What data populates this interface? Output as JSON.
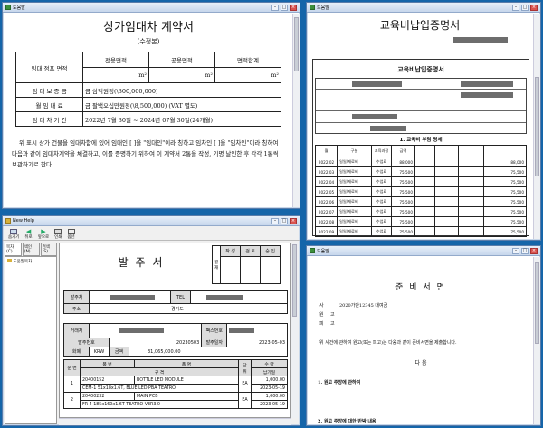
{
  "w1": {
    "title": "도움말",
    "doc": {
      "title": "상가임대차 계약서",
      "subtitle": "(수정본)",
      "row_area": "임대 점포 면적",
      "h_excl": "전용면적",
      "h_common": "공용면적",
      "h_total": "면적합계",
      "unit": "m²",
      "row_deposit": "임 대 보 증 금",
      "deposit": "금 삼억원정(\\300,000,000)",
      "row_rent": "월  임  대  료",
      "rent": "금 팔백오십만원정(\\8,500,000) (VAT 별도)",
      "row_period": "임 대 차 기 간",
      "period": "2022년 7월 30일 ~ 2024년 07월 30일(24개월)",
      "body": "위 표시 상가 건물을 임대차함에 있어 임대인 [          ]을 \"임대인\"이라 칭하고 임차인 [          ]을 \"임차인\"이라 칭하여 다음과 같이 임대차계약을 체결하고, 이를 증명하기 위하여 이 계약서 2통을 작성, 기명 날인한 후 각각 1통씩 보관하기로 한다."
    }
  },
  "w2": {
    "title": "도움말",
    "header": "교육비납입증명서",
    "form_title": "교육비납입증명서",
    "section": "1. 교육비 부담 명세",
    "cols": [
      "월",
      "구분",
      "교육과정",
      "금액"
    ],
    "rows": [
      [
        "2022.02",
        "일일/재료비",
        "수업료",
        "88,000"
      ],
      [
        "2022.03",
        "일일/재료비",
        "수업료",
        "75,500"
      ],
      [
        "2022.04",
        "일일/재료비",
        "수업료",
        "75,500"
      ],
      [
        "2022.05",
        "일일/재료비",
        "수업료",
        "75,500"
      ],
      [
        "2022.06",
        "일일/재료비",
        "수업료",
        "75,500"
      ],
      [
        "2022.07",
        "일일/재료비",
        "수업료",
        "75,500"
      ],
      [
        "2022.08",
        "일일/재료비",
        "수업료",
        "75,500"
      ],
      [
        "2022.09",
        "일일/재료비",
        "수업료",
        "75,500"
      ]
    ],
    "right_values": [
      "88,000",
      "75,500",
      "75,500",
      "75,500",
      "75,500",
      "75,500",
      "75,500",
      "75,500"
    ]
  },
  "w3": {
    "title": "New Help",
    "toolbar": [
      "숨기기",
      "뒤로",
      "앞으로",
      "인쇄",
      "옵션"
    ],
    "tabs": [
      "목차(C)",
      "색인(N)",
      "검색(S)"
    ],
    "tree_item": "도움말목차",
    "doc": {
      "title": "발 주 서",
      "approval": "결재",
      "signers": [
        "작 성",
        "검 토",
        "승 인"
      ],
      "lbl_orderer": "발주처",
      "lbl_tel": "TEL",
      "lbl_addr": "주소",
      "addr": "경기도",
      "lbl_vendor": "거래처",
      "lbl_fax": "팩스번호",
      "lbl_order_no": "발주번호",
      "order_no": "20230503",
      "lbl_order_date": "발주일자",
      "order_date": "2023-05-03",
      "lbl_currency": "화폐",
      "currency": "KRW",
      "lbl_amount": "금액",
      "amount": "31,065,000.00",
      "h_seq": "순 번",
      "h_item": "품 번",
      "h_name": "품 명",
      "h_spec": "규 격",
      "h_unit": "단 위",
      "h_qty": "수 량",
      "h_due": "납기일",
      "items": [
        {
          "seq": "1",
          "code": "20400152",
          "name": "BOTTLE LED MODULE",
          "spec": "CEM-1 51x18x1.6T, BLUE LED PBA TEATRO",
          "unit": "EA",
          "qty": "1,000.00",
          "due": "2023-05-19"
        },
        {
          "seq": "2",
          "code": "20400232",
          "name": "MAIN PCB",
          "spec": "FR-4 185x160x1.6T TEATRO VER3.0",
          "unit": "EA",
          "qty": "1,000.00",
          "due": "2023-05-19"
        }
      ]
    }
  },
  "w4": {
    "title": "도움말",
    "doc": {
      "title": "준 비 서 면",
      "f1l": "사",
      "f1v": "2020가단12345  대여금",
      "f2l": "원",
      "f2v": "고",
      "f3l": "피",
      "f3v": "고",
      "body": "위 사건에 관하여 원고(또는 피고)는 다음과 같이 준비서면을 제출합니다.",
      "sub": "다       음",
      "item1": "1. 원고 주장에 관하여",
      "item2": "2. 원고 주장에 대한 반박 내용"
    }
  }
}
